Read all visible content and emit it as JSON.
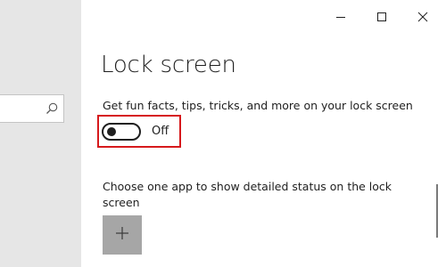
{
  "window": {
    "controls": {
      "minimize": "minimize-icon",
      "maximize": "maximize-icon",
      "close": "close-icon"
    }
  },
  "sidebar": {
    "search": {
      "value": "",
      "placeholder": "",
      "icon": "search-icon"
    }
  },
  "main": {
    "title": "Lock screen",
    "fun_facts": {
      "label": "Get fun facts, tips, tricks, and more on your lock screen",
      "toggle_state": "Off",
      "toggle_on": false
    },
    "detailed_status": {
      "label": "Choose one app to show detailed status on the lock screen",
      "add_button_icon": "plus-icon"
    }
  },
  "colors": {
    "sidebar_bg": "#e6e6e6",
    "highlight": "#d6191c",
    "add_button_bg": "#a6a6a6",
    "text": "#1f1f1f"
  }
}
